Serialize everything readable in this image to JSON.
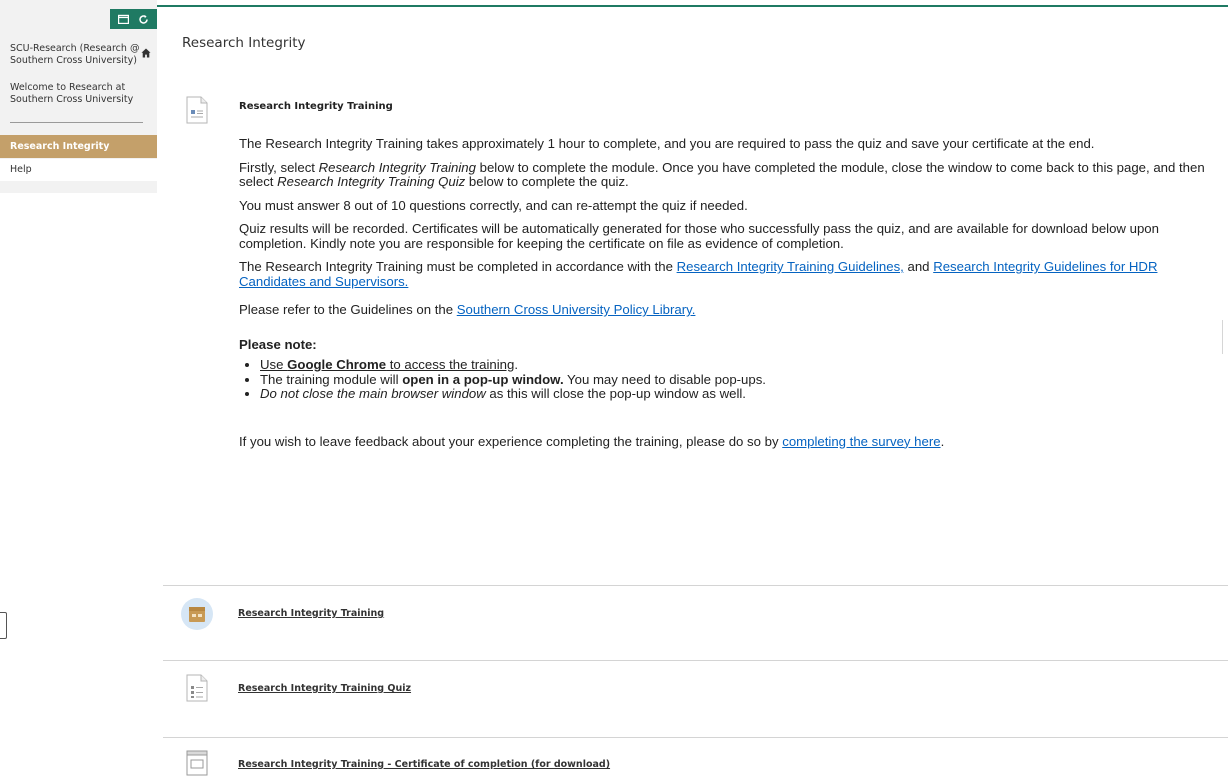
{
  "sidebar": {
    "course_title": "SCU-Research (Research @ Southern Cross University)",
    "welcome": "Welcome to Research at Southern Cross University",
    "items": [
      {
        "label": "Research Integrity",
        "active": true
      },
      {
        "label": "Help",
        "active": false
      }
    ],
    "toolbar_icons": [
      "folder-icon",
      "refresh-icon"
    ],
    "accent_color": "#1f7a63",
    "active_color": "#c4a06a"
  },
  "page": {
    "title": "Research Integrity"
  },
  "item": {
    "title": "Research Integrity Training",
    "para1": "The Research Integrity Training takes approximately 1 hour to complete, and you are required to pass the quiz and save your certificate at the end.",
    "para2_a": "Firstly, select ",
    "para2_em1": "Research Integrity Training",
    "para2_b": " below to complete the module. Once you have completed the module, close the window to come back to this page, and then select ",
    "para2_em2": "Research Integrity Training Quiz",
    "para2_c": " below to complete the quiz.",
    "para3": "You must answer 8 out of 10 questions correctly, and can re-attempt the quiz if needed.",
    "para4": "Quiz results will be recorded. Certificates will be automatically generated for those who successfully pass the quiz, and are available for download below upon completion. Kindly note you are responsible for keeping the certificate on file as evidence of completion.",
    "para5_a": "The Research Integrity Training must be completed in accordance with the ",
    "para5_link1": "Research Integrity Training Guidelines,",
    "para5_b": " and ",
    "para5_link2": "Research Integrity Guidelines for HDR Candidates and Supervisors.",
    "para6_a": "Please refer to the Guidelines on the ",
    "para6_link": "Southern Cross University Policy Library.",
    "note_heading": "Please note:",
    "bullet1_a": "Use ",
    "bullet1_bold": "Google Chrome",
    "bullet1_b": " to access the training",
    "bullet1_c": ".",
    "bullet2_a": "The training module will ",
    "bullet2_bold": "open in a pop-up window.",
    "bullet2_b": " You may need to disable pop-ups.",
    "bullet3_em": "Do not close the main browser window",
    "bullet3_b": " as this will close the pop-up window as well.",
    "feedback_a": "If you wish to leave feedback about your experience completing the training, please do so by ",
    "feedback_link": "completing the survey here",
    "feedback_b": "."
  },
  "content_items": [
    {
      "label": "Research Integrity Training",
      "icon": "scorm-package-icon"
    },
    {
      "label": "Research Integrity Training Quiz",
      "icon": "quiz-document-icon"
    },
    {
      "label": "Research Integrity Training - Certificate of completion (for download)",
      "icon": "certificate-icon"
    }
  ]
}
